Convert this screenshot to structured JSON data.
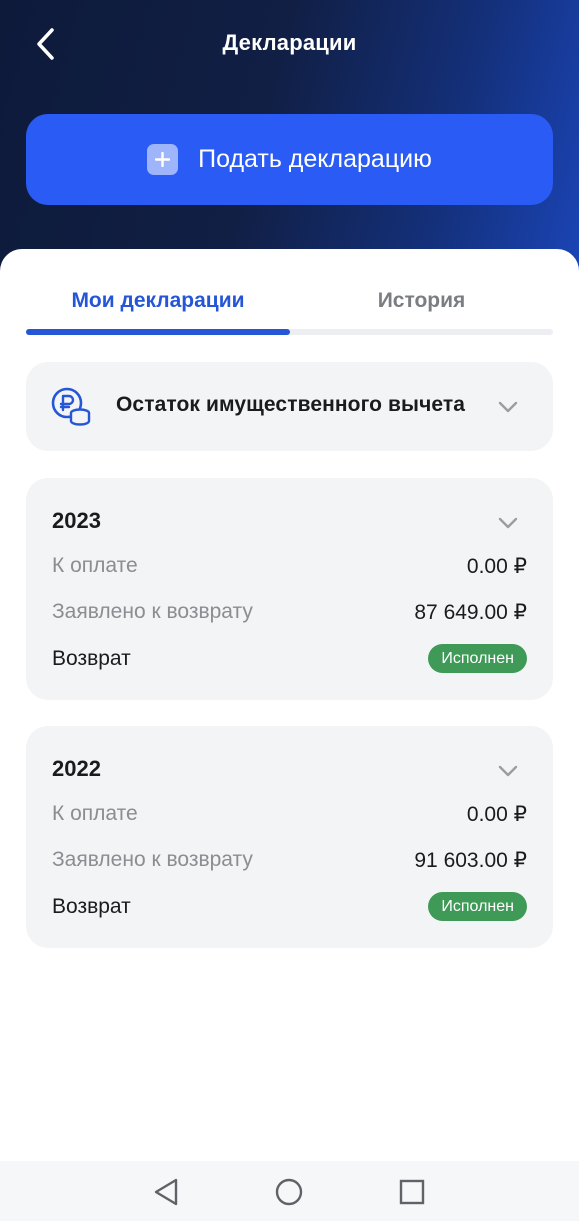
{
  "header": {
    "title": "Декларации",
    "back_icon": "chevron-left-icon",
    "submit_button_label": "Подать декларацию",
    "submit_button_icon": "plus-icon"
  },
  "tabs": [
    {
      "label": "Мои декларации",
      "active": true
    },
    {
      "label": "История",
      "active": false
    }
  ],
  "deduction": {
    "label": "Остаток имущественного вычета",
    "icon": "ruble-coins-icon"
  },
  "declarations": [
    {
      "year": "2023",
      "rows": [
        {
          "label": "К оплате",
          "value": "0.00 ₽"
        },
        {
          "label": "Заявлено к возврату",
          "value": "87 649.00 ₽"
        }
      ],
      "status_label": "Возврат",
      "status_badge": "Исполнен"
    },
    {
      "year": "2022",
      "rows": [
        {
          "label": "К оплате",
          "value": "0.00 ₽"
        },
        {
          "label": "Заявлено к возврату",
          "value": "91 603.00 ₽"
        }
      ],
      "status_label": "Возврат",
      "status_badge": "Исполнен"
    }
  ],
  "colors": {
    "accent": "#2a5cf5",
    "tab_active": "#2456d6",
    "badge_success": "#3f9a57",
    "card_bg": "#f3f4f5"
  },
  "navbar": {
    "back_icon": "triangle-back-icon",
    "home_icon": "circle-home-icon",
    "recent_icon": "square-recent-icon"
  }
}
